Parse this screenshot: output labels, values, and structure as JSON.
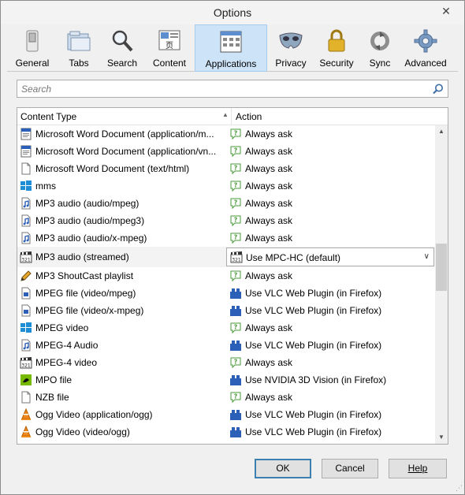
{
  "window": {
    "title": "Options",
    "close_label": "✕"
  },
  "toolbar": {
    "items": [
      {
        "label": "General",
        "icon": "switch-icon",
        "selected": false
      },
      {
        "label": "Tabs",
        "icon": "folders-icon",
        "selected": false
      },
      {
        "label": "Search",
        "icon": "magnifier-icon",
        "selected": false
      },
      {
        "label": "Content",
        "icon": "content-icon",
        "selected": false
      },
      {
        "label": "Applications",
        "icon": "applications-icon",
        "selected": true
      },
      {
        "label": "Privacy",
        "icon": "mask-icon",
        "selected": false
      },
      {
        "label": "Security",
        "icon": "padlock-icon",
        "selected": false
      },
      {
        "label": "Sync",
        "icon": "sync-icon",
        "selected": false
      },
      {
        "label": "Advanced",
        "icon": "gear-icon",
        "selected": false
      }
    ]
  },
  "search": {
    "placeholder": "Search"
  },
  "table": {
    "headers": {
      "content_type": "Content Type",
      "action": "Action"
    },
    "rows": [
      {
        "type": "Microsoft Word Document (application/m...",
        "type_icon": "word-doc-icon",
        "action": "Always ask",
        "action_icon": "ask-icon"
      },
      {
        "type": "Microsoft Word Document (application/vn...",
        "type_icon": "word-doc-icon",
        "action": "Always ask",
        "action_icon": "ask-icon"
      },
      {
        "type": "Microsoft Word Document (text/html)",
        "type_icon": "blank-doc-icon",
        "action": "Always ask",
        "action_icon": "ask-icon"
      },
      {
        "type": "mms",
        "type_icon": "windows-logo-icon",
        "action": "Always ask",
        "action_icon": "ask-icon"
      },
      {
        "type": "MP3 audio (audio/mpeg)",
        "type_icon": "audio-file-icon",
        "action": "Always ask",
        "action_icon": "ask-icon"
      },
      {
        "type": "MP3 audio (audio/mpeg3)",
        "type_icon": "audio-file-icon",
        "action": "Always ask",
        "action_icon": "ask-icon"
      },
      {
        "type": "MP3 audio (audio/x-mpeg)",
        "type_icon": "audio-file-icon",
        "action": "Always ask",
        "action_icon": "ask-icon"
      },
      {
        "type": "MP3 audio (streamed)",
        "type_icon": "clapperboard-icon",
        "action": "Use MPC-HC (default)",
        "action_icon": "clapperboard-icon",
        "selected": true
      },
      {
        "type": "MP3 ShoutCast playlist",
        "type_icon": "pencil-icon",
        "action": "Always ask",
        "action_icon": "ask-icon"
      },
      {
        "type": "MPEG file (video/mpeg)",
        "type_icon": "video-file-icon",
        "action": "Use VLC Web Plugin (in Firefox)",
        "action_icon": "plugin-icon"
      },
      {
        "type": "MPEG file (video/x-mpeg)",
        "type_icon": "video-file-icon",
        "action": "Use VLC Web Plugin (in Firefox)",
        "action_icon": "plugin-icon"
      },
      {
        "type": "MPEG video",
        "type_icon": "windows-logo-icon",
        "action": "Always ask",
        "action_icon": "ask-icon"
      },
      {
        "type": "MPEG-4 Audio",
        "type_icon": "audio-file-icon",
        "action": "Use VLC Web Plugin (in Firefox)",
        "action_icon": "plugin-icon"
      },
      {
        "type": "MPEG-4 video",
        "type_icon": "clapperboard-icon",
        "action": "Always ask",
        "action_icon": "ask-icon"
      },
      {
        "type": "MPO file",
        "type_icon": "nvidia-icon",
        "action": "Use NVIDIA 3D Vision (in Firefox)",
        "action_icon": "plugin-icon"
      },
      {
        "type": "NZB file",
        "type_icon": "blank-doc-icon",
        "action": "Always ask",
        "action_icon": "ask-icon"
      },
      {
        "type": "Ogg Video (application/ogg)",
        "type_icon": "vlc-cone-icon",
        "action": "Use VLC Web Plugin (in Firefox)",
        "action_icon": "plugin-icon"
      },
      {
        "type": "Ogg Video (video/ogg)",
        "type_icon": "vlc-cone-icon",
        "action": "Use VLC Web Plugin (in Firefox)",
        "action_icon": "plugin-icon"
      }
    ]
  },
  "buttons": {
    "ok": "OK",
    "cancel": "Cancel",
    "help": "Help"
  },
  "colors": {
    "selected_tab_bg": "#cde3f7",
    "ok_border": "#3c7fb1",
    "plugin_blue": "#2b5fb8",
    "ask_green": "#4a9a3a"
  }
}
